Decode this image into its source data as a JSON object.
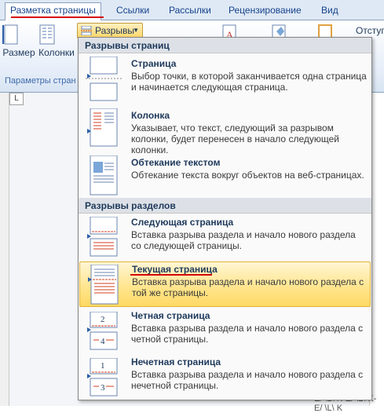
{
  "ribbon": {
    "tabs": [
      "Разметка страницы",
      "Ссылки",
      "Рассылки",
      "Рецензирование",
      "Вид"
    ],
    "buttons": {
      "size": "Размер",
      "columns": "Колонки",
      "breaks": "Разрывы"
    },
    "group_label": "Параметры стран",
    "right_label": "Отступ"
  },
  "ruler_mark": "L",
  "doc_fragment": "E/ \\L\\ K-E/ \\L\\ K-E/ \\L\\ K",
  "menu": {
    "page_breaks_header": "Разрывы страниц",
    "section_breaks_header": "Разрывы разделов",
    "items": [
      {
        "title": "Страница",
        "desc": "Выбор точки, в которой заканчивается одна страница и начинается следующая страница."
      },
      {
        "title": "Колонка",
        "desc": "Указывает, что текст, следующий за разрывом колонки, будет перенесен в начало следующей колонки."
      },
      {
        "title": "Обтекание текстом",
        "desc": "Обтекание текста вокруг объектов на веб-страницах."
      },
      {
        "title": "Следующая страница",
        "desc": "Вставка разрыва раздела и начало нового раздела со следующей страницы."
      },
      {
        "title": "Текущая страница",
        "desc": "Вставка разрыва раздела и начало нового раздела с той же страницы."
      },
      {
        "title": "Четная страница",
        "desc": "Вставка разрыва раздела и начало нового раздела с четной страницы."
      },
      {
        "title": "Нечетная страница",
        "desc": "Вставка разрыва раздела и начало нового раздела с нечетной страницы."
      }
    ],
    "even_icon_numbers": [
      "2",
      "4"
    ],
    "odd_icon_numbers": [
      "1",
      "3"
    ]
  },
  "colors": {
    "highlight": "#ffe48a",
    "annotation_red": "#d40000",
    "ribbon_text": "#15428b"
  }
}
